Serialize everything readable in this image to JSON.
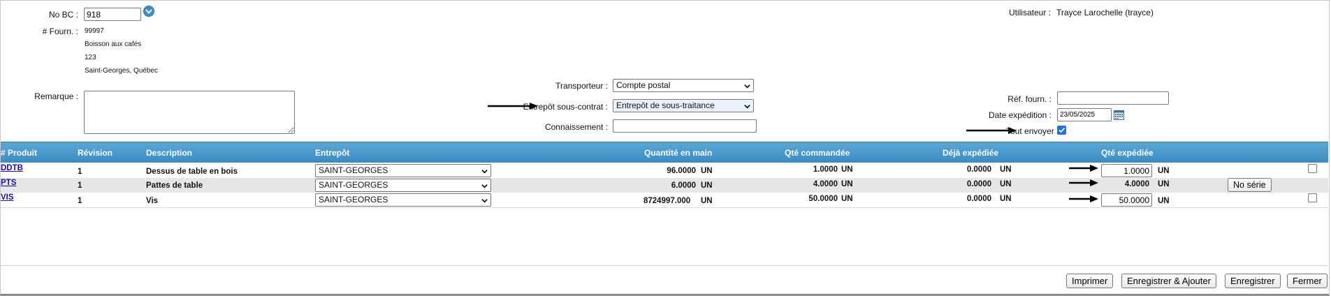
{
  "header": {
    "no_bc_label": "No BC :",
    "no_bc_value": "918",
    "fourn_label": "# Fourn. :",
    "supplier_number": "99997",
    "supplier_name": "Boisson aux cafés",
    "supplier_address": "123",
    "supplier_city": "Saint-Georges, Québec",
    "user_label": "Utilisateur :",
    "user_value": "Trayce Larochelle (trayce)"
  },
  "form": {
    "remarque_label": "Remarque :",
    "remarque_value": "",
    "transporteur_label": "Transporteur :",
    "transporteur_value": "Compte postal",
    "entrepot_sc_label": "Entrepôt sous-contrat :",
    "entrepot_sc_value": "Entrepôt de sous-traitance",
    "connaissement_label": "Connaissement :",
    "connaissement_value": "",
    "ref_fourn_label": "Réf. fourn. :",
    "ref_fourn_value": "",
    "date_exp_label": "Date expédition :",
    "date_exp_value": "23/05/2025",
    "tout_envoyer_label": "Tout envoyer :",
    "tout_envoyer_checked": true
  },
  "table": {
    "columns": {
      "produit": "# Produit",
      "revision": "Révision",
      "description": "Description",
      "entrepot": "Entrepôt",
      "qte_main": "Quantité en main",
      "qte_commandee": "Qté commandée",
      "deja_expediee": "Déjà expédiée",
      "qte_expediee": "Qté expédiée"
    },
    "rows": [
      {
        "produit": "DDTB",
        "revision": "1",
        "description": "Dessus de table en bois",
        "entrepot": "SAINT-GEORGES",
        "qte_main": "96.0000",
        "qte_main_unit": "UN",
        "qte_commandee": "1.0000",
        "qte_commandee_unit": "UN",
        "deja_expediee": "0.0000",
        "deja_expediee_unit": "UN",
        "qte_expediee": "1.0000",
        "qte_expediee_unit": "UN"
      },
      {
        "produit": "PTS",
        "revision": "1",
        "description": "Pattes de table",
        "entrepot": "SAINT-GEORGES",
        "qte_main": "6.0000",
        "qte_main_unit": "UN",
        "qte_commandee": "4.0000",
        "qte_commandee_unit": "UN",
        "deja_expediee": "0.0000",
        "deja_expediee_unit": "UN",
        "qte_expediee": "4.0000",
        "qte_expediee_unit": "UN",
        "serial_button": "No série"
      },
      {
        "produit": "VIS",
        "revision": "1",
        "description": "Vis",
        "entrepot": "SAINT-GEORGES",
        "qte_main": "8724997.000",
        "qte_main_unit": "UN",
        "qte_commandee": "50.0000",
        "qte_commandee_unit": "UN",
        "deja_expediee": "0.0000",
        "deja_expediee_unit": "UN",
        "qte_expediee": "50.0000",
        "qte_expediee_unit": "UN"
      }
    ]
  },
  "footer": {
    "imprimer": "Imprimer",
    "enregistrer_ajouter": "Enregistrer & Ajouter",
    "enregistrer": "Enregistrer",
    "fermer": "Fermer"
  },
  "colors": {
    "header_blue": "#3a8cc4",
    "link": "#1a0dab",
    "check_blue": "#1a73e8"
  }
}
